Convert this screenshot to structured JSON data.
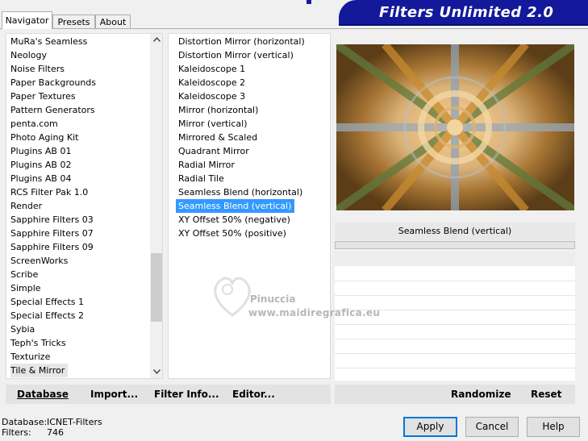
{
  "tabs": [
    {
      "label": "Navigator"
    },
    {
      "label": "Presets"
    },
    {
      "label": "About"
    }
  ],
  "banner": {
    "title": "Filters Unlimited 2.0"
  },
  "categories": [
    "MuRa's Seamless",
    "Neology",
    "Noise Filters",
    "Paper Backgrounds",
    "Paper Textures",
    "Pattern Generators",
    "penta.com",
    "Photo Aging Kit",
    "Plugins AB 01",
    "Plugins AB 02",
    "Plugins AB 04",
    "RCS Filter Pak 1.0",
    "Render",
    "Sapphire Filters 03",
    "Sapphire Filters 07",
    "Sapphire Filters 09",
    "ScreenWorks",
    "Scribe",
    "Simple",
    "Special Effects 1",
    "Special Effects 2",
    "Sybia",
    "Teph's Tricks",
    "Texturize",
    "Tile & Mirror"
  ],
  "selected_category": "Tile & Mirror",
  "filters": [
    "Distortion Mirror (horizontal)",
    "Distortion Mirror (vertical)",
    "Kaleidoscope 1",
    "Kaleidoscope 2",
    "Kaleidoscope 3",
    "Mirror (horizontal)",
    "Mirror (vertical)",
    "Mirrored & Scaled",
    "Quadrant Mirror",
    "Radial Mirror",
    "Radial Tile",
    "Seamless Blend (horizontal)",
    "Seamless Blend (vertical)",
    "XY Offset 50% (negative)",
    "XY Offset 50% (positive)"
  ],
  "selected_filter": "Seamless Blend (vertical)",
  "preview": {
    "label": "Seamless Blend (vertical)"
  },
  "watermark": {
    "name": "Pinuccia",
    "url": "www.maidiregrafica.eu"
  },
  "left_bar": {
    "database": "Database",
    "import": "Import...",
    "filter_info": "Filter Info...",
    "editor": "Editor..."
  },
  "right_bar": {
    "randomize": "Randomize",
    "reset": "Reset"
  },
  "footer": {
    "database_label": "Database:",
    "database_value": "ICNET-Filters",
    "filters_label": "Filters:",
    "filters_value": "746"
  },
  "buttons": {
    "apply": "Apply",
    "cancel": "Cancel",
    "help": "Help"
  },
  "colors": {
    "selection": "#3399ff",
    "banner": "#13199a",
    "default_button_border": "#0078d7"
  },
  "icons": [
    "scroll-up-icon",
    "scroll-down-icon",
    "watermark-logo-icon"
  ]
}
